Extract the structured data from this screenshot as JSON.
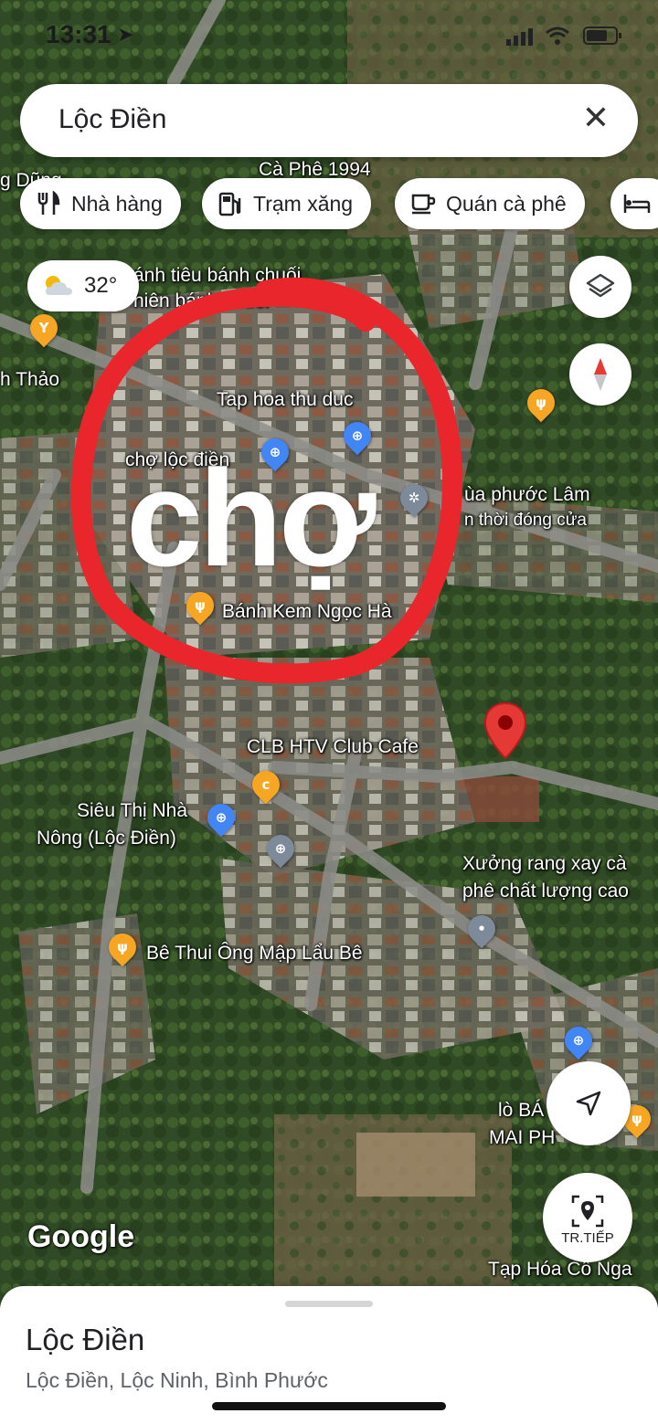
{
  "status": {
    "time": "13:31"
  },
  "search": {
    "query": "Lộc Điền"
  },
  "chips": [
    {
      "label": "Nhà hàng",
      "icon": "restaurant-icon"
    },
    {
      "label": "Trạm xăng",
      "icon": "gas-station-icon"
    },
    {
      "label": "Quán cà phê",
      "icon": "coffee-icon"
    }
  ],
  "weather": {
    "temp": "32°",
    "icon": "partly-cloudy-icon"
  },
  "map_labels": {
    "ca_phe_1994": "Cà Phê 1994",
    "g_dung": "g Dũng",
    "banh_tieu": "ánh tiêu bánh chuối",
    "banh_chien": "hiên bánh chuối",
    "h_thao": "h Thảo",
    "tap_hoa_thu_duc": "Tap hoa thu duc",
    "cho_loc_dien": "chợ lộc điền",
    "chua_phuoc_lam": "ùa phước Lâm",
    "tam_thoi_dong_cua": "n thời đóng cửa",
    "banh_kem": "Bánh Kem Ngọc Hà",
    "clb_htv": "CLB HTV Club Cafe",
    "sieu_thi_1": "Siêu Thị Nhà",
    "sieu_thi_2": "Nông (Lộc Điền)",
    "xuong_rang_1": "Xưởng rang xay cà",
    "xuong_rang_2": "phê chất lượng cao",
    "be_thui": "Bê Thui Ông Mập Lẩu Bê",
    "lo_ba_1": "lò BÁ",
    "lo_ba_2": "MAI PH",
    "tap_hoa_co_nga": "Tạp Hóa Cô Nga"
  },
  "annotation": {
    "text": "chợ",
    "circle_color": "#e8262c"
  },
  "buttons": {
    "directions_label": "TR.TIẾP"
  },
  "branding": {
    "logo": "Google"
  },
  "sheet": {
    "title": "Lộc Điền",
    "address": "Lộc Điền, Lộc Ninh, Bình Phước"
  },
  "colors": {
    "pin_red": "#e53935",
    "pin_blue": "#4285f4",
    "pin_orange": "#f6a623",
    "pin_gray": "#7d8a99"
  }
}
